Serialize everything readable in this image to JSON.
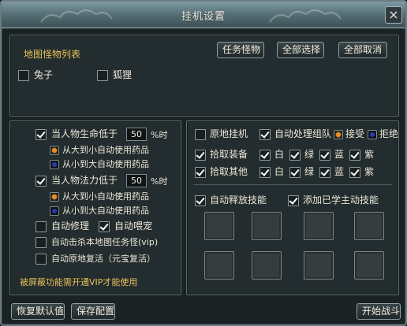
{
  "window": {
    "title": "挂机设置",
    "close_label": "×"
  },
  "monsters": {
    "label": "地图怪物列表",
    "buttons": {
      "task": "任务怪物",
      "select_all": "全部选择",
      "cancel_all": "全部取消"
    },
    "items": [
      {
        "name": "兔子",
        "checked": false
      },
      {
        "name": "狐狸",
        "checked": false
      }
    ]
  },
  "left": {
    "hp": {
      "label": "当人物生命低于",
      "value": "50",
      "unit": "%时",
      "checked": true
    },
    "hp_options": [
      {
        "label": "从大到小自动使用药品",
        "selected": true
      },
      {
        "label": "从小到大自动使用药品",
        "selected": false
      }
    ],
    "mp": {
      "label": "当人物法力低于",
      "value": "50",
      "unit": "%时",
      "checked": true
    },
    "mp_options": [
      {
        "label": "从大到小自动使用药品",
        "selected": true
      },
      {
        "label": "从小到大自动使用药品",
        "selected": false
      }
    ],
    "auto_repair": {
      "label": "自动修理",
      "checked": false
    },
    "auto_feed": {
      "label": "自动喂宠",
      "checked": true
    },
    "auto_kill": {
      "label": "自动击杀本地图任务怪(vip)",
      "checked": false
    },
    "auto_revive": {
      "label": "自动原地复活（元宝复活）",
      "checked": false
    },
    "notice": "被屏蔽功能需开通VIP才能使用"
  },
  "right": {
    "idle_in_place": {
      "label": "原地挂机",
      "checked": false
    },
    "auto_team": {
      "label": "自动处理组队",
      "checked": true
    },
    "team_accept": {
      "label": "接受",
      "selected": true
    },
    "team_reject": {
      "label": "拒绝",
      "selected": false
    },
    "pickup_equip": {
      "label": "拾取装备",
      "checked": true
    },
    "pickup_other": {
      "label": "拾取其他",
      "checked": true
    },
    "quality": {
      "white": "白",
      "green": "绿",
      "blue": "蓝",
      "purple": "紫"
    },
    "auto_skill": {
      "label": "自动释放技能",
      "checked": true
    },
    "add_skill": {
      "label": "添加已学主动技能",
      "checked": true
    },
    "skill_slots": 8
  },
  "footer": {
    "restore": "恢复默认值",
    "save": "保存配置",
    "start": "开始战斗"
  },
  "colors": {
    "accent_text": "#e6c15a",
    "radio_on": "#f0901c",
    "radio_off": "#2a3bb0",
    "panel_bg": "#232c2e"
  }
}
